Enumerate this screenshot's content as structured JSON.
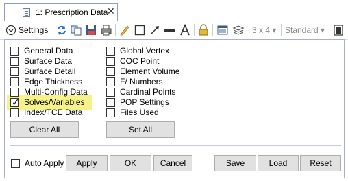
{
  "tab": {
    "label": "1: Prescription Data",
    "close": "✕"
  },
  "toolbar": {
    "settings_label": "Settings",
    "grid_combo": "3 x 4 ▾",
    "style_combo": "Standard ▾",
    "icons": [
      "settings-chevron-icon",
      "refresh-icon",
      "copy-icon",
      "save-icon",
      "print-icon",
      "pencil-icon",
      "rectangle-icon",
      "arrow-icon",
      "line-icon",
      "text-icon",
      "lock-icon",
      "window-icon",
      "layers-icon",
      "grid-combo",
      "style-combo",
      "panel-icon"
    ]
  },
  "checkboxes_left": [
    {
      "label": "General Data",
      "checked": false
    },
    {
      "label": "Surface Data",
      "checked": false
    },
    {
      "label": "Surface Detail",
      "checked": false
    },
    {
      "label": "Edge Thickness",
      "checked": false
    },
    {
      "label": "Multi-Config Data",
      "checked": false
    },
    {
      "label": "Solves/Variables",
      "checked": true
    },
    {
      "label": "Index/TCE Data",
      "checked": false
    }
  ],
  "checkboxes_right": [
    {
      "label": "Global Vertex",
      "checked": false
    },
    {
      "label": "COC Point",
      "checked": false
    },
    {
      "label": "Element Volume",
      "checked": false
    },
    {
      "label": "F/ Numbers",
      "checked": false
    },
    {
      "label": "Cardinal Points",
      "checked": false
    },
    {
      "label": "POP Settings",
      "checked": false
    },
    {
      "label": "Files Used",
      "checked": false
    }
  ],
  "buttons": {
    "clear_all": "Clear All",
    "set_all": "Set All",
    "apply": "Apply",
    "ok": "OK",
    "cancel": "Cancel",
    "save": "Save",
    "load": "Load",
    "reset": "Reset"
  },
  "auto_apply": {
    "label": "Auto Apply",
    "checked": false
  },
  "colors": {
    "highlight": "#f5f28a",
    "tab_border": "#8ba0bf",
    "button_face": "#e1e1e1"
  }
}
